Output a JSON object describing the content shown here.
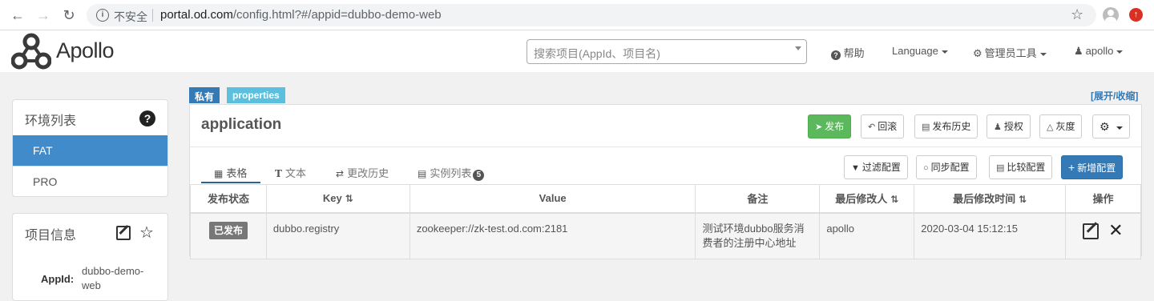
{
  "browser": {
    "insecure_label": "不安全",
    "url_host": "portal.od.com",
    "url_path": "/config.html?#/appid=dubbo-demo-web"
  },
  "header": {
    "logo_text": "Apollo",
    "search_placeholder": "搜索项目(AppId、项目名)",
    "help": "帮助",
    "language": "Language",
    "admin_tools": "管理员工具",
    "user": "apollo"
  },
  "env_panel": {
    "title": "环境列表",
    "items": [
      {
        "label": "FAT",
        "active": true
      },
      {
        "label": "PRO",
        "active": false
      }
    ]
  },
  "info_panel": {
    "title": "项目信息",
    "appid_label": "AppId:",
    "appid_value": "dubbo-demo-web"
  },
  "namespace": {
    "tag_private": "私有",
    "tag_format": "properties",
    "expand_toggle": "[展开/收缩]",
    "name": "application",
    "actions": {
      "publish": "发布",
      "rollback": "回滚",
      "publish_history": "发布历史",
      "authorize": "授权",
      "gray": "灰度"
    },
    "tabs": [
      {
        "label": "表格",
        "icon": "table-icon"
      },
      {
        "label": "文本",
        "icon": "text-icon"
      },
      {
        "label": "更改历史",
        "icon": "history-icon"
      },
      {
        "label": "实例列表",
        "icon": "instances-icon",
        "badge": "5"
      }
    ],
    "tools": {
      "filter": "过滤配置",
      "sync": "同步配置",
      "compare": "比较配置",
      "add": "新增配置"
    },
    "table": {
      "headers": [
        "发布状态",
        "Key",
        "Value",
        "备注",
        "最后修改人",
        "最后修改时间",
        "操作"
      ],
      "rows": [
        {
          "status": "已发布",
          "key": "dubbo.registry",
          "value": "zookeeper://zk-test.od.com:2181",
          "comment": "测试环境dubbo服务消费者的注册中心地址",
          "modifier": "apollo",
          "modified_time": "2020-03-04 15:12:15"
        }
      ]
    }
  }
}
